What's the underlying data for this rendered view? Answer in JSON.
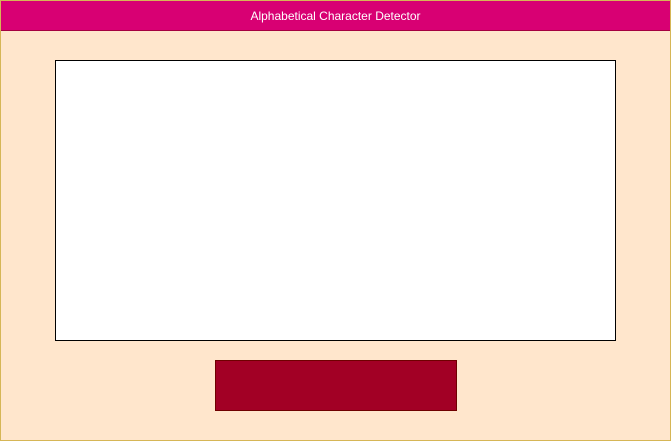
{
  "window": {
    "title": "Alphabetical Character Detector"
  },
  "colors": {
    "background": "#ffe6cc",
    "window_border": "#d6b656",
    "title_bar": "#d80073",
    "canvas": "#ffffff",
    "button": "#a20025"
  },
  "canvas": {
    "content": ""
  },
  "action_button": {
    "label": ""
  }
}
